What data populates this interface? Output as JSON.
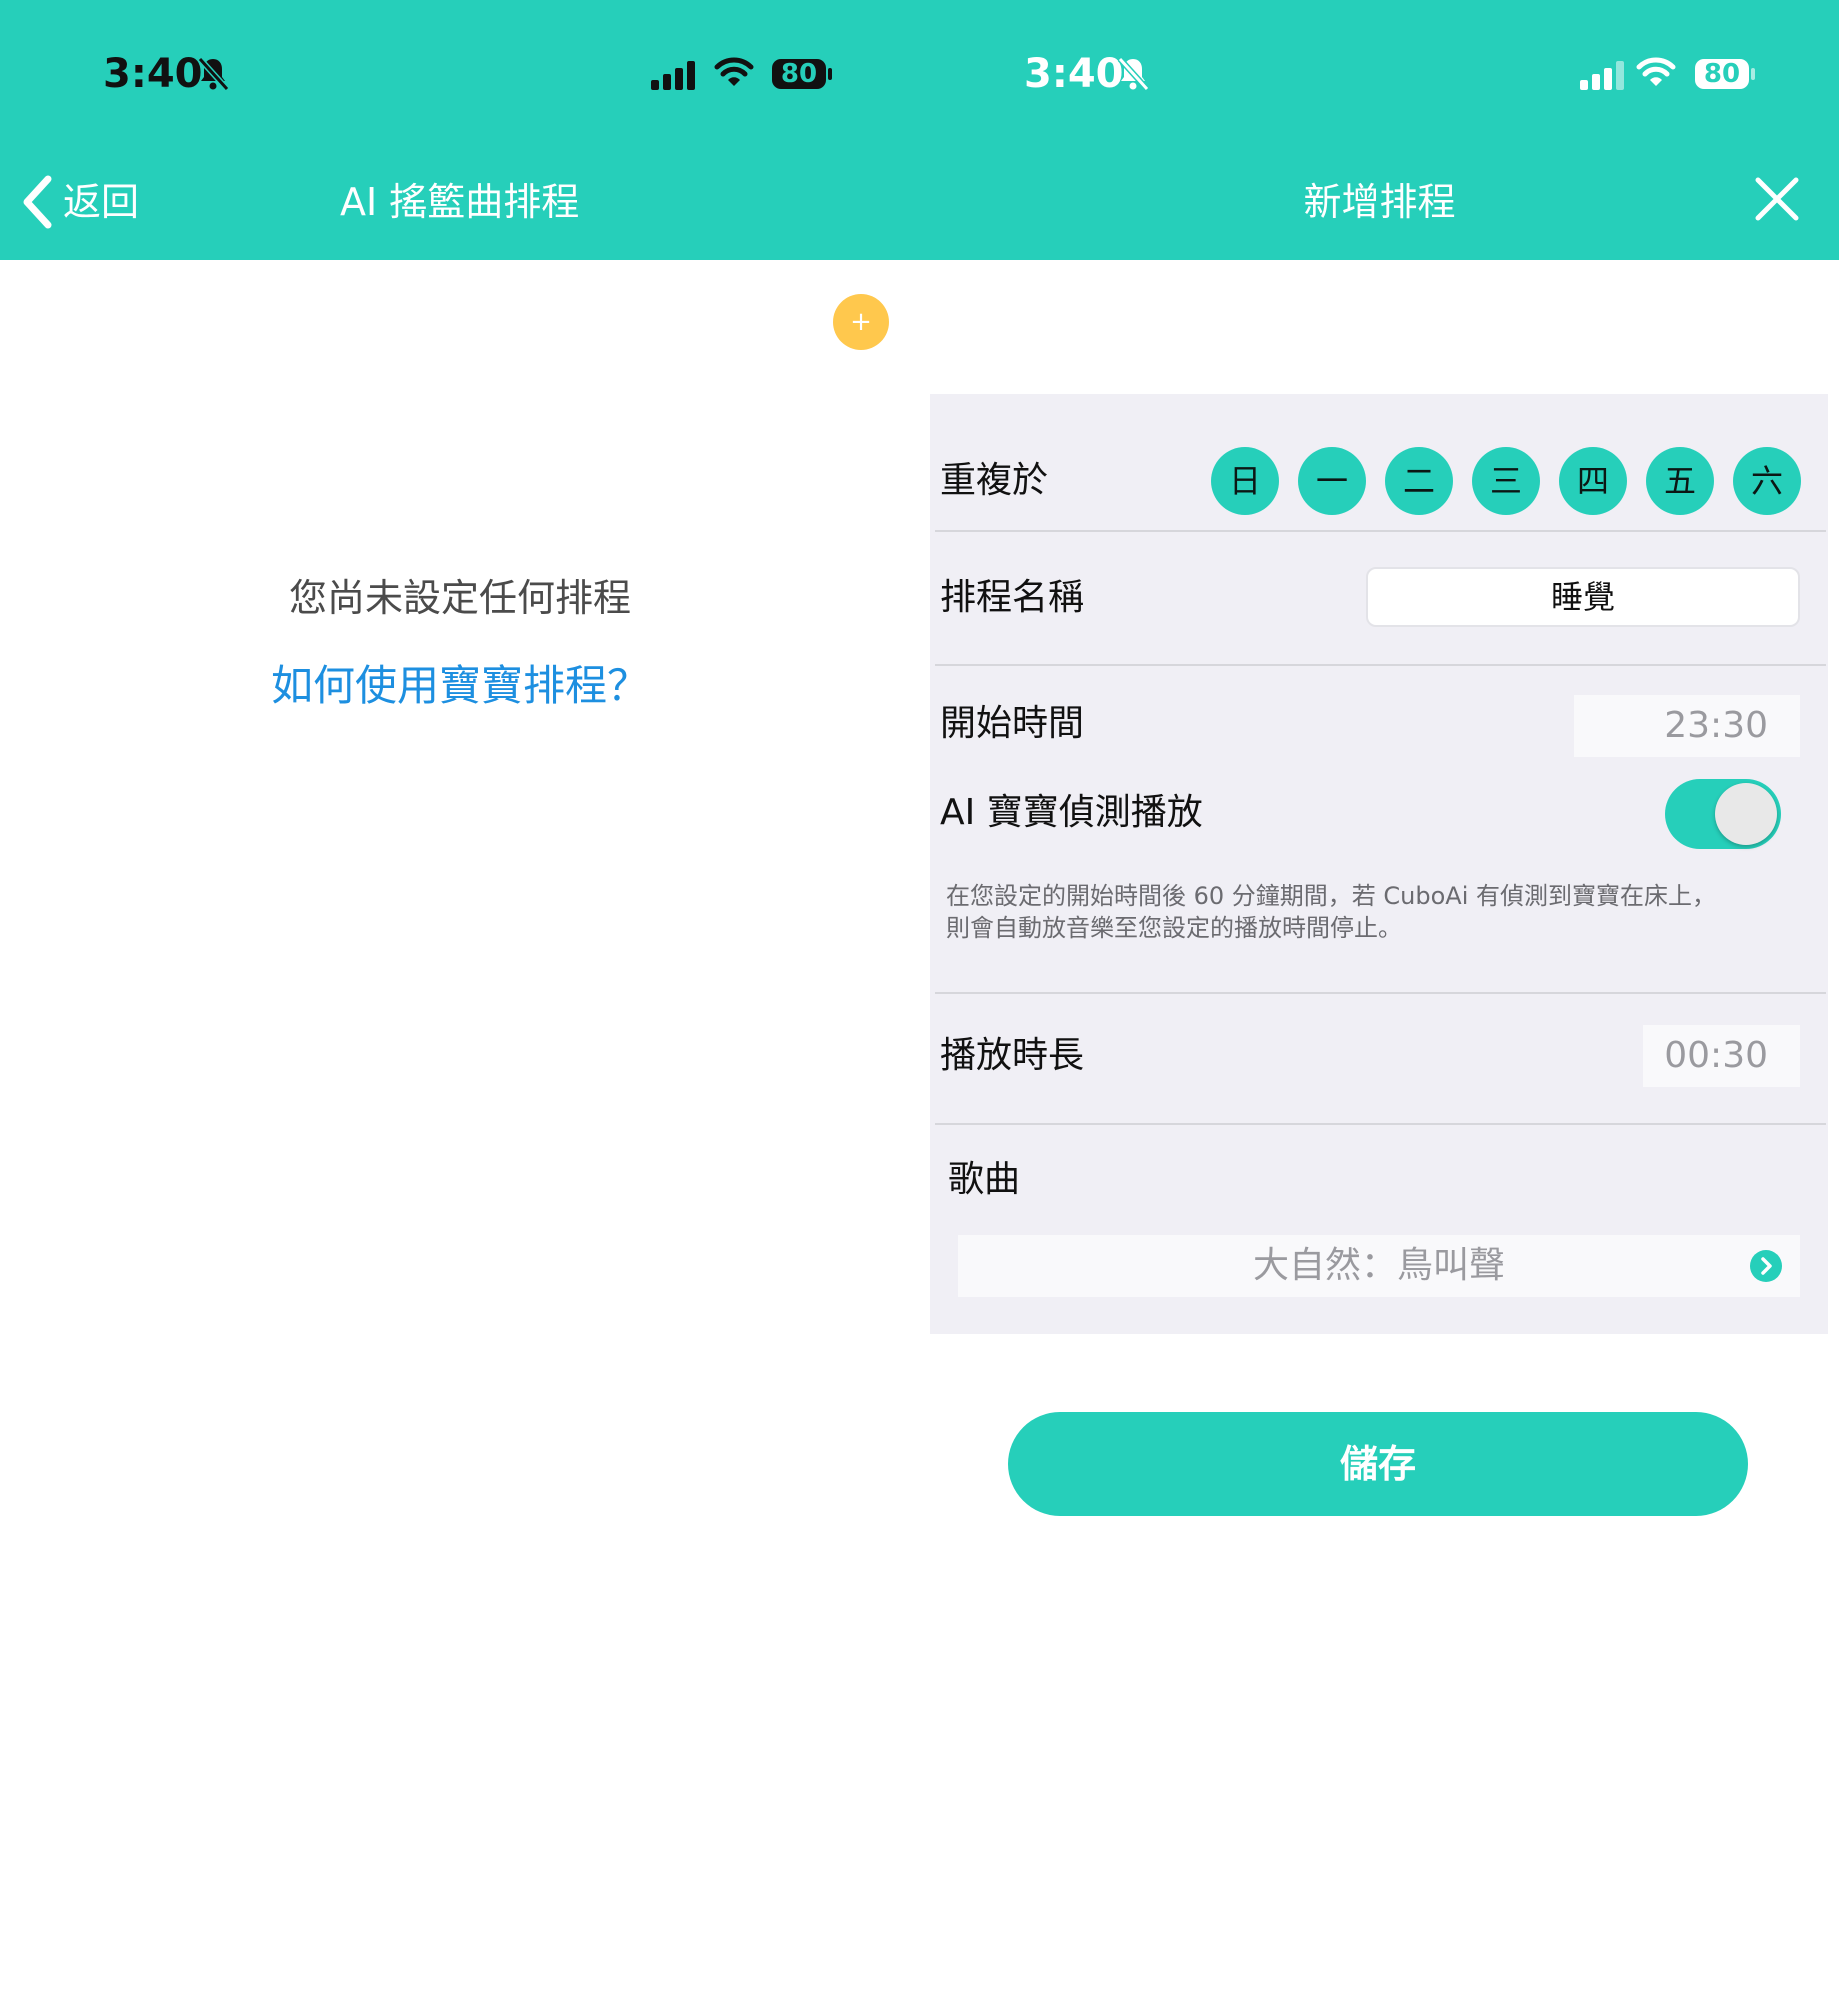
{
  "left": {
    "status": {
      "time": "3:40",
      "battery": "80"
    },
    "nav": {
      "back_label": "返回",
      "title": "AI 搖籃曲排程"
    },
    "empty_message": "您尚未設定任何排程",
    "help_link": "如何使用寶寶排程？",
    "add_button_symbol": "+"
  },
  "right": {
    "status": {
      "time": "3:40",
      "battery": "80"
    },
    "nav": {
      "title": "新增排程"
    },
    "form": {
      "repeat_label": "重複於",
      "days": [
        "日",
        "一",
        "二",
        "三",
        "四",
        "五",
        "六"
      ],
      "name_label": "排程名稱",
      "name_value": "睡覺",
      "start_label": "開始時間",
      "start_value": "23:30",
      "ai_label": "AI 寶寶偵測播放",
      "ai_enabled": true,
      "ai_description_line1": "在您設定的開始時間後 60 分鐘期間，若 CuboAi 有偵測到寶寶在床上，",
      "ai_description_line2": "則會自動放音樂至您設定的播放時間停止。",
      "duration_label": "播放時長",
      "duration_value": "00:30",
      "song_label": "歌曲",
      "song_value": "大自然：鳥叫聲"
    },
    "save_label": "儲存"
  },
  "colors": {
    "brand": "#26cfba",
    "add_button": "#ffc84d",
    "link": "#1d8fe0",
    "form_bg": "#f0eff5"
  },
  "icons": [
    "bell-slash-icon",
    "cellular-signal-icon",
    "wifi-icon",
    "battery-icon",
    "chevron-left-icon",
    "close-icon",
    "chevron-right-icon",
    "plus-icon"
  ]
}
